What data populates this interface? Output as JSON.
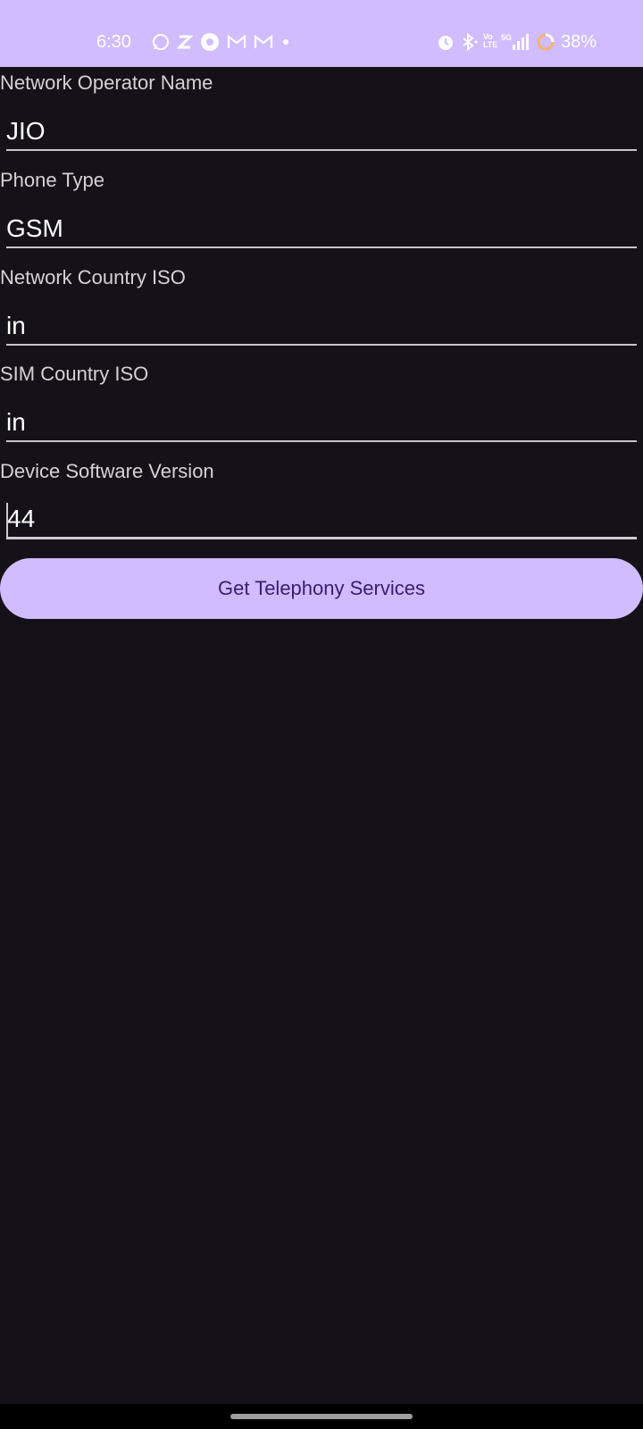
{
  "status_bar": {
    "time": "6:30",
    "left_icons": [
      "whatsapp-icon",
      "z-app-icon",
      "chrome-icon",
      "gmail-icon",
      "gmail-icon",
      "more-notifications-dot-icon"
    ],
    "right_icons": [
      "alarm-icon",
      "bluetooth-icon",
      "volte-icon",
      "5g-signal-icon",
      "battery-icon"
    ],
    "volte_label": "Vo LTE",
    "network_label": "5G",
    "battery_percent": "38%",
    "background_color": "#d0bcff"
  },
  "fields": [
    {
      "label": "Network Operator Name",
      "value": "JIO"
    },
    {
      "label": "Phone Type",
      "value": "GSM"
    },
    {
      "label": "Network Country ISO",
      "value": "in"
    },
    {
      "label": "SIM Country ISO",
      "value": "in"
    },
    {
      "label": "Device Software Version",
      "value": "44"
    }
  ],
  "button": {
    "label": "Get Telephony Services"
  },
  "colors": {
    "background": "#141218",
    "accent": "#d0bcff",
    "button_text": "#381e72"
  }
}
